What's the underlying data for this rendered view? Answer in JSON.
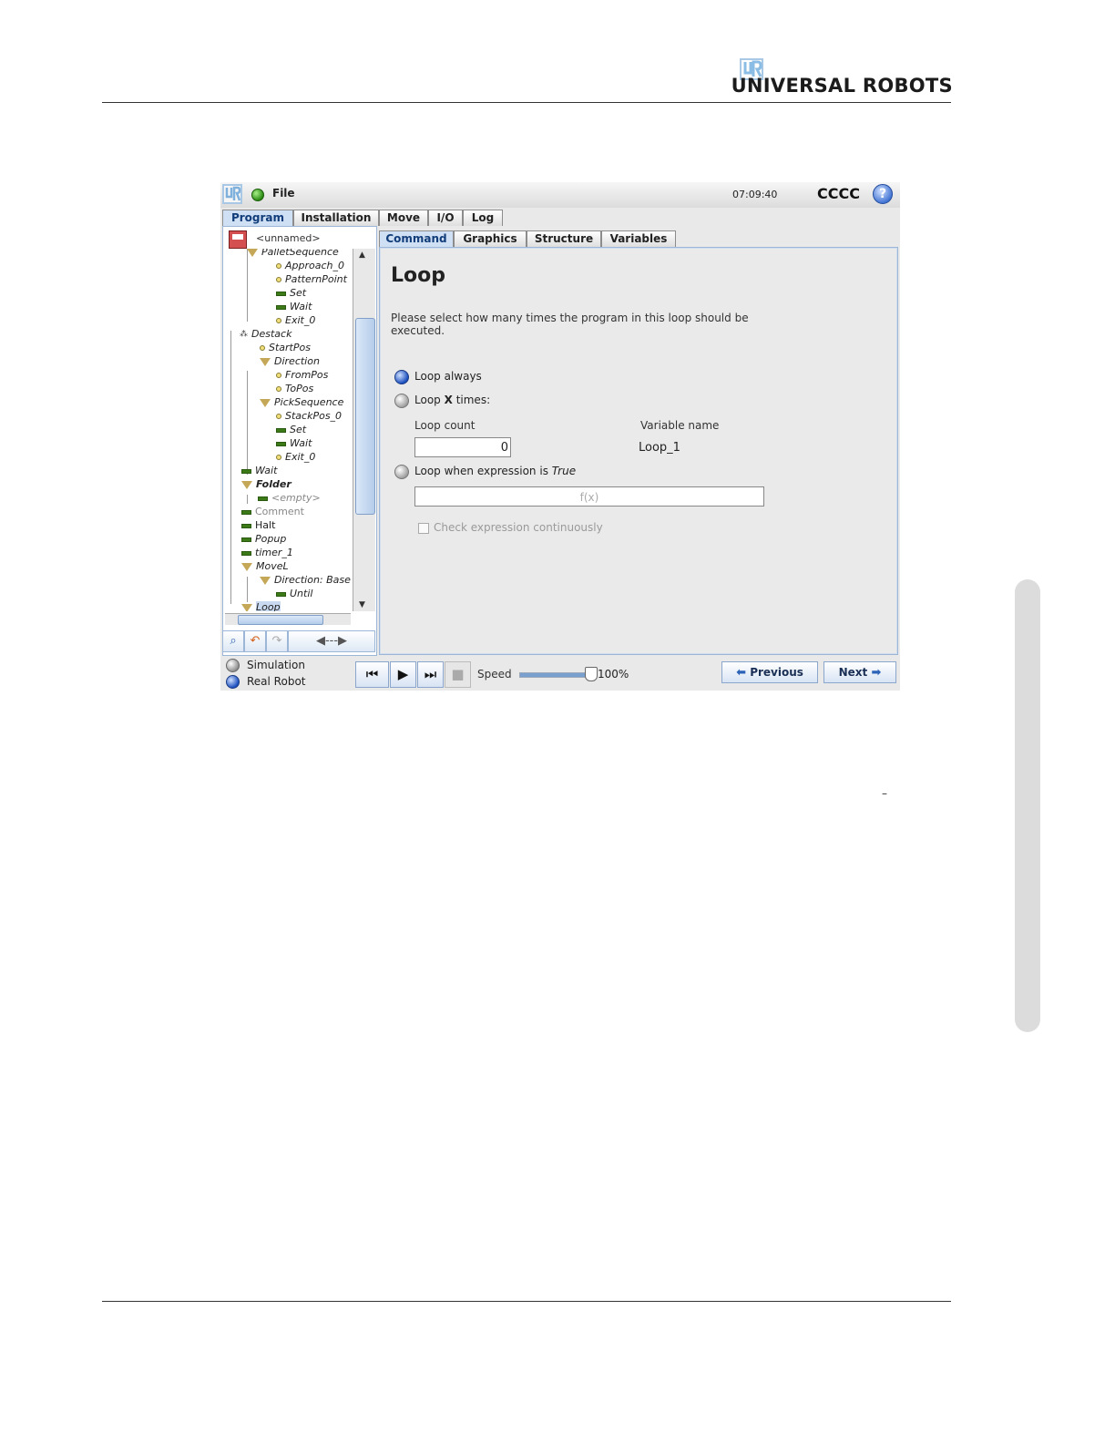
{
  "brand": {
    "name": "UNIVERSAL ROBOTS",
    "logo_icon": "ur-logo-icon"
  },
  "stray_mark": "–",
  "app": {
    "menu": {
      "file_label": "File"
    },
    "clock": "07:09:40",
    "robot_name": "CCCC",
    "help_label": "?",
    "main_tabs": [
      {
        "label": "Program",
        "active": true
      },
      {
        "label": "Installation"
      },
      {
        "label": "Move"
      },
      {
        "label": "I/O"
      },
      {
        "label": "Log"
      }
    ],
    "program_name": "<unnamed>",
    "tree": [
      {
        "label": "PalletSequence"
      },
      {
        "label": "Approach_0"
      },
      {
        "label": "PatternPoint"
      },
      {
        "label": "Set"
      },
      {
        "label": "Wait"
      },
      {
        "label": "Exit_0"
      },
      {
        "label": "Destack"
      },
      {
        "label": "StartPos"
      },
      {
        "label": "Direction"
      },
      {
        "label": "FromPos"
      },
      {
        "label": "ToPos"
      },
      {
        "label": "PickSequence"
      },
      {
        "label": "StackPos_0"
      },
      {
        "label": "Set"
      },
      {
        "label": "Wait"
      },
      {
        "label": "Exit_0"
      },
      {
        "label": "Wait"
      },
      {
        "label": "Folder"
      },
      {
        "label": "<empty>"
      },
      {
        "label": "Comment"
      },
      {
        "label": "Halt"
      },
      {
        "label": "Popup"
      },
      {
        "label": "timer_1"
      },
      {
        "label": "MoveL"
      },
      {
        "label": "Direction: Base"
      },
      {
        "label": "Until"
      },
      {
        "label": "Loop",
        "selected": true
      }
    ],
    "sub_tabs": [
      {
        "label": "Command",
        "active": true
      },
      {
        "label": "Graphics"
      },
      {
        "label": "Structure"
      },
      {
        "label": "Variables"
      }
    ],
    "command": {
      "title": "Loop",
      "description": "Please select how many times the program in this loop should be executed.",
      "option_always": "Loop always",
      "option_times_prefix": "Loop",
      "option_times_var": "X",
      "option_times_suffix": "times:",
      "loop_count_label": "Loop count",
      "loop_count_value": "0",
      "variable_name_label": "Variable name",
      "variable_name_value": "Loop_1",
      "option_expr_prefix": "Loop when expression is",
      "option_expr_keyword": "True",
      "expression_placeholder": "f(x)",
      "check_continuous_label": "Check expression continuously",
      "selected_option": "always"
    },
    "toolbar": {
      "move_tool_label": "◀---▶"
    },
    "modes": [
      {
        "label": "Simulation",
        "selected": false
      },
      {
        "label": "Real Robot",
        "selected": true
      }
    ],
    "speed": {
      "label": "Speed",
      "value": "100%",
      "fraction": 1.0
    },
    "nav": {
      "previous_label": "Previous",
      "next_label": "Next"
    },
    "colors": {
      "accent": "#2c63b8",
      "status_ok": "#2a8a12",
      "selection": "#c9d9ef"
    }
  }
}
